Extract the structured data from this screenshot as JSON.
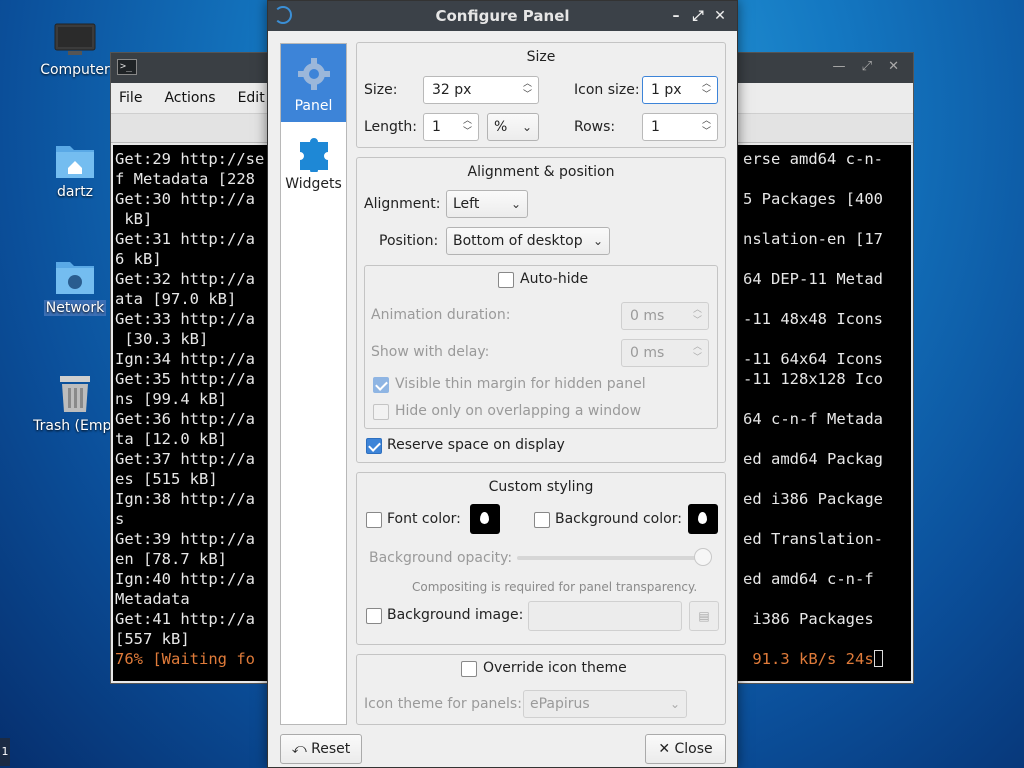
{
  "desktop": {
    "icons": [
      {
        "label": "Computer"
      },
      {
        "label": "dartz"
      },
      {
        "label": "Network"
      },
      {
        "label": "Trash (Empt"
      }
    ],
    "taskbar_hint": "1"
  },
  "terminal": {
    "menu": [
      "File",
      "Actions",
      "Edit"
    ],
    "lines": [
      {
        "l": "Get:29 http://se",
        "r": "erse amd64 c-n-"
      },
      {
        "l": "f Metadata [228",
        "r": ""
      },
      {
        "l": "Get:30 http://a",
        "r": "5 Packages [400"
      },
      {
        "l": " kB]",
        "r": ""
      },
      {
        "l": "Get:31 http://a",
        "r": "nslation-en [17"
      },
      {
        "l": "6 kB]",
        "r": ""
      },
      {
        "l": "Get:32 http://a",
        "r": "64 DEP-11 Metad"
      },
      {
        "l": "ata [97.0 kB]",
        "r": ""
      },
      {
        "l": "Get:33 http://a",
        "r": "-11 48x48 Icons"
      },
      {
        "l": " [30.3 kB]",
        "r": ""
      },
      {
        "l": "Ign:34 http://a",
        "r": "-11 64x64 Icons"
      },
      {
        "l": "Get:35 http://a",
        "r": "-11 128x128 Ico"
      },
      {
        "l": "ns [99.4 kB]",
        "r": ""
      },
      {
        "l": "Get:36 http://a",
        "r": "64 c-n-f Metada"
      },
      {
        "l": "ta [12.0 kB]",
        "r": ""
      },
      {
        "l": "Get:37 http://a",
        "r": "ed amd64 Packag"
      },
      {
        "l": "es [515 kB]",
        "r": ""
      },
      {
        "l": "Ign:38 http://a",
        "r": "ed i386 Package"
      },
      {
        "l": "s",
        "r": ""
      },
      {
        "l": "Get:39 http://a",
        "r": "ed Translation-"
      },
      {
        "l": "en [78.7 kB]",
        "r": ""
      },
      {
        "l": "Ign:40 http://a",
        "r": "ed amd64 c-n-f"
      },
      {
        "l": "Metadata",
        "r": ""
      },
      {
        "l": "Get:41 http://a",
        "r": " i386 Packages"
      },
      {
        "l": "[557 kB]",
        "r": ""
      }
    ],
    "progress_line": {
      "l": "76% [Waiting fo",
      "r": " 91.3 kB/s 24s"
    }
  },
  "dialog": {
    "title": "Configure Panel",
    "sidebar": [
      {
        "label": "Panel"
      },
      {
        "label": "Widgets"
      }
    ],
    "size_group": {
      "title": "Size",
      "size_label": "Size:",
      "size_value": "32 px",
      "icon_size_label": "Icon size:",
      "icon_size_value": "1 px",
      "length_label": "Length:",
      "length_value": "1",
      "length_unit": "%",
      "rows_label": "Rows:",
      "rows_value": "1"
    },
    "align_group": {
      "title": "Alignment & position",
      "alignment_label": "Alignment:",
      "alignment_value": "Left",
      "position_label": "Position:",
      "position_value": "Bottom of desktop",
      "autohide_label": "Auto-hide",
      "anim_label": "Animation duration:",
      "anim_value": "0 ms",
      "delay_label": "Show with delay:",
      "delay_value": "0 ms",
      "thin_margin_label": "Visible thin margin for hidden panel",
      "hide_overlap_label": "Hide only on overlapping a window",
      "reserve_label": "Reserve space on display"
    },
    "style_group": {
      "title": "Custom styling",
      "font_color_label": "Font color:",
      "bg_color_label": "Background color:",
      "opacity_label": "Background opacity:",
      "opacity_value": 1.0,
      "compositing_note": "Compositing is required for panel transparency.",
      "bg_image_label": "Background image:"
    },
    "icon_theme_group": {
      "override_label": "Override icon theme",
      "theme_label": "Icon theme for panels:",
      "theme_value": "ePapirus"
    },
    "reset_label": "Reset",
    "close_label": "Close"
  }
}
